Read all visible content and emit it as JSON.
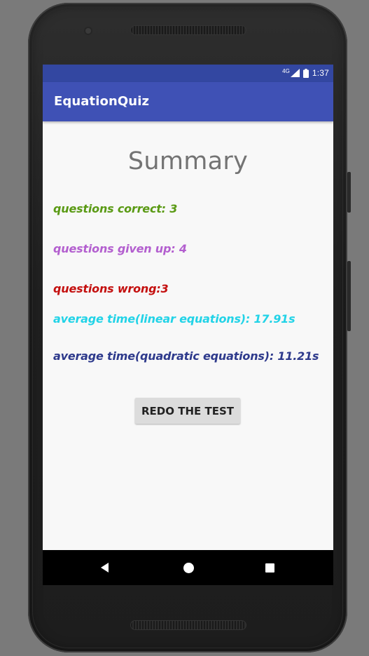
{
  "status_bar": {
    "network": "4G",
    "time": "1:37"
  },
  "app_bar": {
    "title": "EquationQuiz"
  },
  "summary": {
    "heading": "Summary",
    "stats": [
      {
        "text": "questions correct: 3",
        "color": "#5a9a14"
      },
      {
        "text": "questions given up: 4",
        "color": "#b35fcf"
      },
      {
        "text": "questions wrong:3",
        "color": "#c4100f"
      },
      {
        "text": "average time(linear equations): 17.91s",
        "color": "#22d3e7"
      },
      {
        "text": "average time(quadratic equations): 11.21s",
        "color": "#2e3a8c"
      }
    ],
    "redo_label": "REDO THE TEST"
  },
  "nav_bar": {
    "icons": [
      "back-icon",
      "home-icon",
      "recent-apps-icon"
    ]
  },
  "colors": {
    "status_bar": "#3347a1",
    "app_bar": "#3f51b5",
    "screen_background": "#f8f8f8",
    "button_background": "#dcdcdc"
  }
}
